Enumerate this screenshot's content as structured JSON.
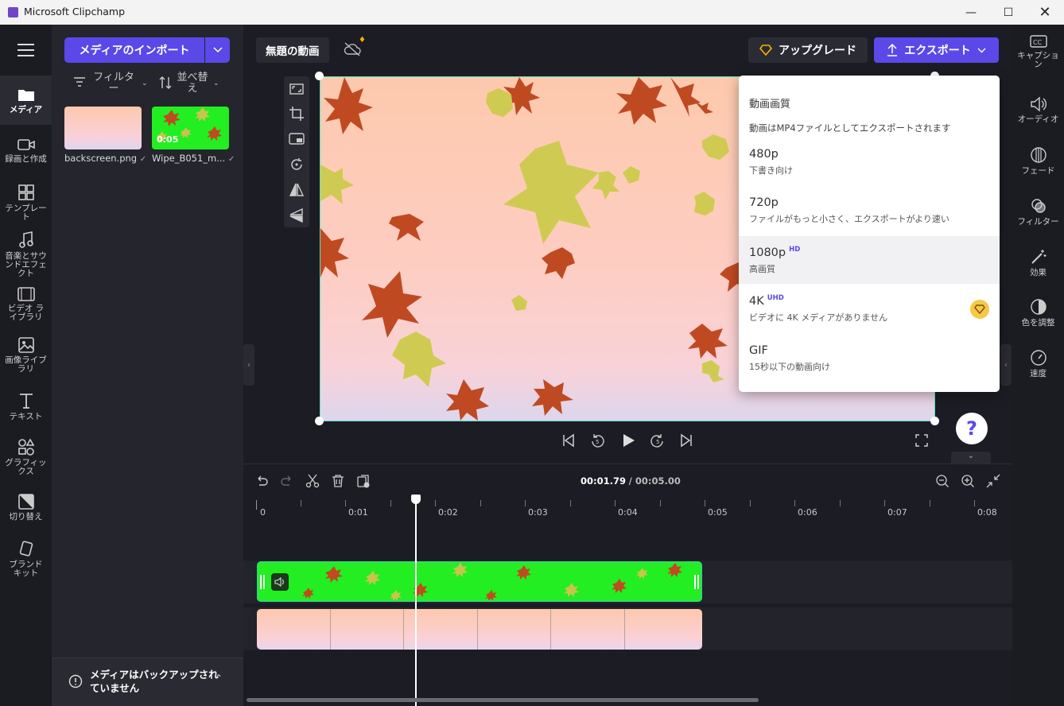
{
  "window": {
    "title": "Microsoft Clipchamp"
  },
  "rail": [
    {
      "label": "メディア",
      "icon": "folder-icon"
    },
    {
      "label": "録画と作成",
      "icon": "video-camera-icon"
    },
    {
      "label": "テンプレート",
      "icon": "templates-icon"
    },
    {
      "label": "音楽とサウンドエフェクト",
      "icon": "music-note-icon"
    },
    {
      "label": "ビデオ ライブラリ",
      "icon": "film-icon"
    },
    {
      "label": "画像ライブラリ",
      "icon": "image-icon"
    },
    {
      "label": "テキスト",
      "icon": "text-icon"
    },
    {
      "label": "グラフィックス",
      "icon": "shapes-icon"
    },
    {
      "label": "切り替え",
      "icon": "transition-icon"
    },
    {
      "label": "ブランド キット",
      "icon": "brand-kit-icon"
    }
  ],
  "media": {
    "import_label": "メディアのインポート",
    "filter_label": "フィルター",
    "sort_label": "並べ替え",
    "items": [
      {
        "name": "backscreen.png",
        "duration": ""
      },
      {
        "name": "Wipe_B051_m...",
        "duration": "0:05"
      }
    ],
    "backup_notice": "メディアはバックアップされていません"
  },
  "project": {
    "title": "無題の動画"
  },
  "header": {
    "upgrade_label": "アップグレード",
    "export_label": "エクスポート"
  },
  "export_menu": {
    "heading": "動画画質",
    "note": "動画はMP4ファイルとしてエクスポートされます",
    "options": [
      {
        "quality": "480p",
        "badge": "",
        "desc": "下書き向け"
      },
      {
        "quality": "720p",
        "badge": "",
        "desc": "ファイルがもっと小さく、エクスポートがより速い"
      },
      {
        "quality": "1080p",
        "badge": "HD",
        "desc": "高画質"
      },
      {
        "quality": "4K",
        "badge": "UHD",
        "desc": "ビデオに 4K メディアがありません"
      },
      {
        "quality": "GIF",
        "badge": "",
        "desc": "15秒以下の動画向け"
      }
    ]
  },
  "right_rail": [
    {
      "label": "キャプション",
      "icon": "cc-icon"
    },
    {
      "label": "オーディオ",
      "icon": "speaker-icon"
    },
    {
      "label": "フェード",
      "icon": "fade-icon"
    },
    {
      "label": "フィルター",
      "icon": "filter-circles-icon"
    },
    {
      "label": "効果",
      "icon": "magic-wand-icon"
    },
    {
      "label": "色を調整",
      "icon": "color-adjust-icon"
    },
    {
      "label": "速度",
      "icon": "speedometer-icon"
    }
  ],
  "help_label": "?",
  "timeline": {
    "current_time": "00:01.79",
    "total_time": "/ 00:05.00",
    "ticks": [
      "0",
      "0:01",
      "0:02",
      "0:03",
      "0:04",
      "0:05",
      "0:06",
      "0:07",
      "0:08"
    ]
  },
  "colors": {
    "accent": "#5b48e8",
    "green_screen": "#22ee22",
    "selection": "#5be0c0"
  }
}
